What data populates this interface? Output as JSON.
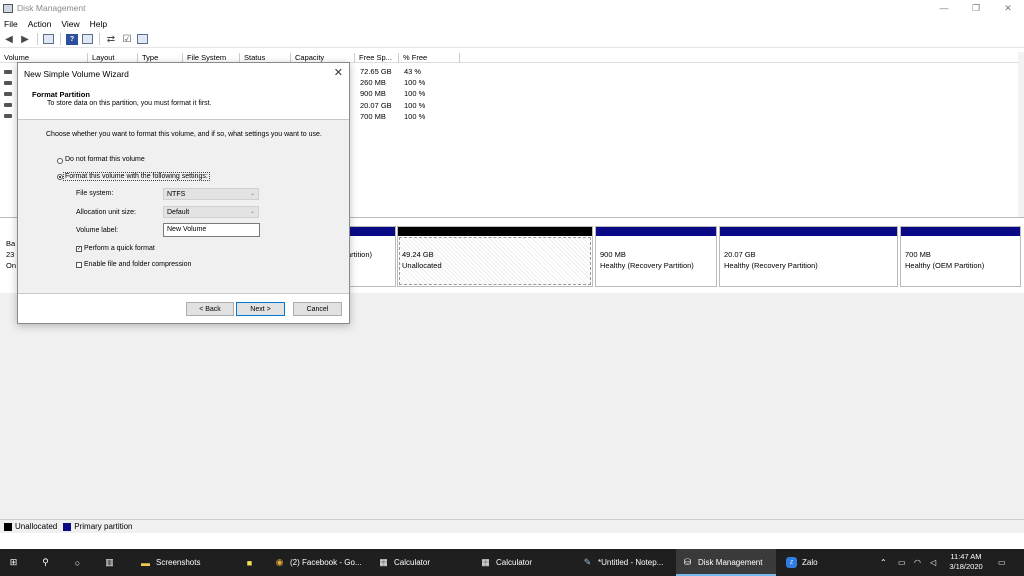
{
  "window": {
    "title": "Disk Management",
    "minimize_icon": "—",
    "restore_icon": "❐",
    "close_icon": "✕"
  },
  "menu": [
    "File",
    "Action",
    "View",
    "Help"
  ],
  "volume_table": {
    "columns": [
      "Volume",
      "Layout",
      "Type",
      "File System",
      "Status",
      "Capacity",
      "Free Sp...",
      "% Free"
    ],
    "rows": [
      {
        "vol": "(",
        "free": "72.65 GB",
        "pct": "43 %"
      },
      {
        "vol": "(",
        "free": "260 MB",
        "pct": "100 %"
      },
      {
        "vol": "(",
        "free": "900 MB",
        "pct": "100 %"
      },
      {
        "vol": "(",
        "free": "20.07 GB",
        "pct": "100 %"
      },
      {
        "vol": "(",
        "free": "700 MB",
        "pct": "100 %"
      }
    ]
  },
  "disk": {
    "label_line1": "Ba",
    "label_line2": "23",
    "label_line3": "On",
    "partitions": [
      {
        "size": "",
        "status": "artition)"
      },
      {
        "size": "49.24 GB",
        "status": "Unallocated"
      },
      {
        "size": "900 MB",
        "status": "Healthy (Recovery Partition)"
      },
      {
        "size": "20.07 GB",
        "status": "Healthy (Recovery Partition)"
      },
      {
        "size": "700 MB",
        "status": "Healthy (OEM Partition)"
      }
    ]
  },
  "legend": {
    "unallocated": "Unallocated",
    "primary": "Primary partition",
    "unallocated_color": "#000000",
    "primary_color": "#0a0a87"
  },
  "wizard": {
    "title": "New Simple Volume Wizard",
    "close": "✕",
    "heading": "Format Partition",
    "subheading": "To store data on this partition, you must format it first.",
    "instruction": "Choose whether you want to format this volume, and if so, what settings you want to use.",
    "opt_no_format": "Do not format this volume",
    "opt_format": "Format this volume with the following settings:",
    "fs_label": "File system:",
    "fs_value": "NTFS",
    "alloc_label": "Allocation unit size:",
    "alloc_value": "Default",
    "vol_label": "Volume label:",
    "vol_value": "New Volume",
    "quick_format": "Perform a quick format",
    "compression": "Enable file and folder compression",
    "back": "< Back",
    "next": "Next >",
    "cancel": "Cancel"
  },
  "taskbar": {
    "items": [
      {
        "label": "Screenshots"
      },
      {
        "label": "(2) Facebook - Go..."
      },
      {
        "label": "Calculator"
      },
      {
        "label": "Calculator"
      },
      {
        "label": "*Untitled - Notep..."
      },
      {
        "label": "Disk Management"
      },
      {
        "label": "Zalo"
      }
    ],
    "time": "11:47 AM",
    "date": "3/18/2020"
  }
}
